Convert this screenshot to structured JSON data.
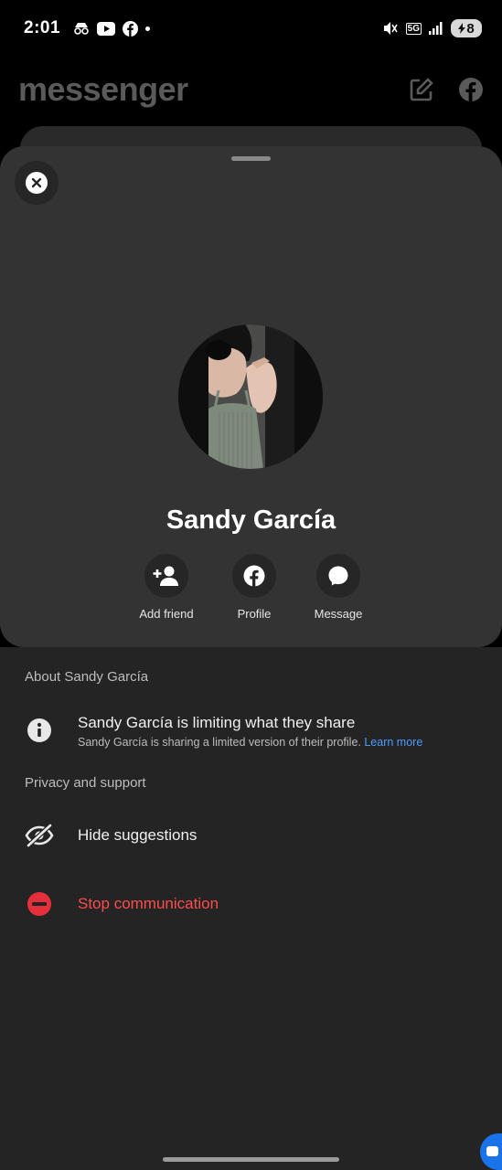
{
  "status_bar": {
    "time": "2:01",
    "network": "5G",
    "battery": "8"
  },
  "background_app": {
    "title": "messenger"
  },
  "profile_card": {
    "name": "Sandy García",
    "actions": [
      {
        "label": "Add friend",
        "icon": "add-friend-icon"
      },
      {
        "label": "Profile",
        "icon": "facebook-icon"
      },
      {
        "label": "Message",
        "icon": "message-bubble-icon"
      }
    ]
  },
  "about": {
    "heading": "About Sandy García",
    "info_title": "Sandy García is limiting what they share",
    "info_subtitle": "Sandy García is sharing a limited version of their profile.",
    "learn_more": "Learn more"
  },
  "privacy": {
    "heading": "Privacy and support",
    "hide_label": "Hide suggestions",
    "stop_label": "Stop communication"
  },
  "colors": {
    "accent_link": "#4c9dff",
    "danger": "#ff4d4d",
    "card_bg": "#333333",
    "sheet_bg": "#242424"
  }
}
